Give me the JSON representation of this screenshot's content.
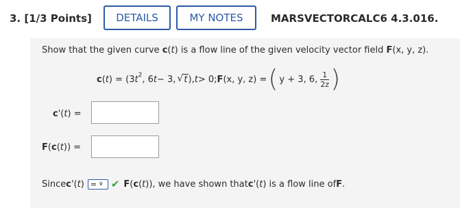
{
  "header": {
    "question_number": "3.",
    "points": "[1/3 Points]",
    "details_label": "DETAILS",
    "mynotes_label": "MY NOTES",
    "code": "MARSVECTORCALC6 4.3.016."
  },
  "problem": {
    "prompt_a": "Show that the given curve ",
    "prompt_c": "c",
    "prompt_b": "(",
    "prompt_t": "t",
    "prompt_after": ") is a flow line of the given velocity vector field ",
    "prompt_F": "F",
    "prompt_args": "(x, y, z).",
    "math": {
      "c": "c",
      "ct_open": "(",
      "t1": "t",
      "ct_close": ") = (3",
      "t2": "t",
      "exp": "2",
      "part2": ", 6",
      "t3": "t",
      "part3": " − 3, ",
      "sqrt_symbol": "√",
      "t4": "t",
      "part4": "), ",
      "t5": "t",
      "part5": " > 0; ",
      "F": "F",
      "F_args": "(x, y, z) = ",
      "comp1": "y + 3, 6,",
      "frac_num": "1",
      "frac_den": "2z"
    }
  },
  "answers": {
    "cprime_label_c": "c",
    "cprime_label_rest": "'(",
    "cprime_label_t": "t",
    "cprime_label_end": ")  =",
    "cprime_value": "",
    "Fc_label_F": "F",
    "Fc_label_open": "(",
    "Fc_label_c": "c",
    "Fc_label_mid": "(",
    "Fc_label_t": "t",
    "Fc_label_end": "))  =",
    "Fc_value": ""
  },
  "conclusion": {
    "since": "Since ",
    "c": "c",
    "prime_open": "'(",
    "t": "t",
    "prime_close": ")",
    "select_value": "=",
    "select_arrow": "∨",
    "check": "✔",
    "F": "F",
    "Fc_open": "(",
    "Fc_c": "c",
    "Fc_open2": "(",
    "Fc_t": "t",
    "Fc_close": ")), we have shown that ",
    "c2": "c",
    "prime2": "'(",
    "t2": "t",
    "after": ") is a flow line of ",
    "F2": "F",
    "period": "."
  }
}
